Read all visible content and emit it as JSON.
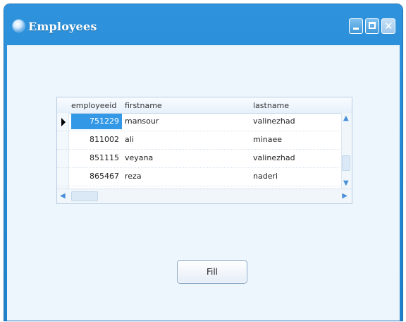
{
  "window": {
    "title": "Employees",
    "title_icon": "app-globe-icon",
    "controls": [
      "minimize",
      "maximize",
      "close"
    ],
    "accent_color": "#1f80cc"
  },
  "grid": {
    "columns": [
      "employeeid",
      "firstname",
      "lastname"
    ],
    "rows": [
      {
        "employeeid": "751229",
        "firstname": "mansour",
        "lastname": "valinezhad",
        "selected": true
      },
      {
        "employeeid": "811002",
        "firstname": "ali",
        "lastname": "minaee",
        "selected": false
      },
      {
        "employeeid": "851115",
        "firstname": "veyana",
        "lastname": "valinezhad",
        "selected": false
      },
      {
        "employeeid": "865467",
        "firstname": "reza",
        "lastname": "naderi",
        "selected": false
      }
    ],
    "selection_color": "#3399e6"
  },
  "buttons": {
    "fill_label": "Fill"
  }
}
